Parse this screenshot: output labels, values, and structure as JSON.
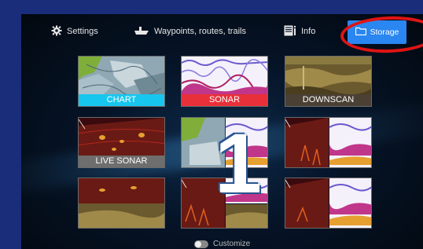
{
  "nav": {
    "settings": {
      "label": "Settings",
      "icon": "gear-icon"
    },
    "waypoints": {
      "label": "Waypoints, routes, trails",
      "icon": "boat-icon"
    },
    "info": {
      "label": "Info",
      "icon": "info-icon"
    },
    "storage": {
      "label": "Storage",
      "icon": "folder-icon"
    }
  },
  "tiles": {
    "chart": {
      "label": "CHART"
    },
    "sonar": {
      "label": "SONAR"
    },
    "downscan": {
      "label": "DOWNSCAN"
    },
    "live_sonar": {
      "label": "LIVE SONAR"
    }
  },
  "overlay_number": "1",
  "footer": {
    "customize_label": "Customize"
  },
  "colors": {
    "accent": "#2a86f0",
    "chart_label": "#17c6ef",
    "sonar_label": "#e8303a",
    "highlight": "#e01414"
  }
}
